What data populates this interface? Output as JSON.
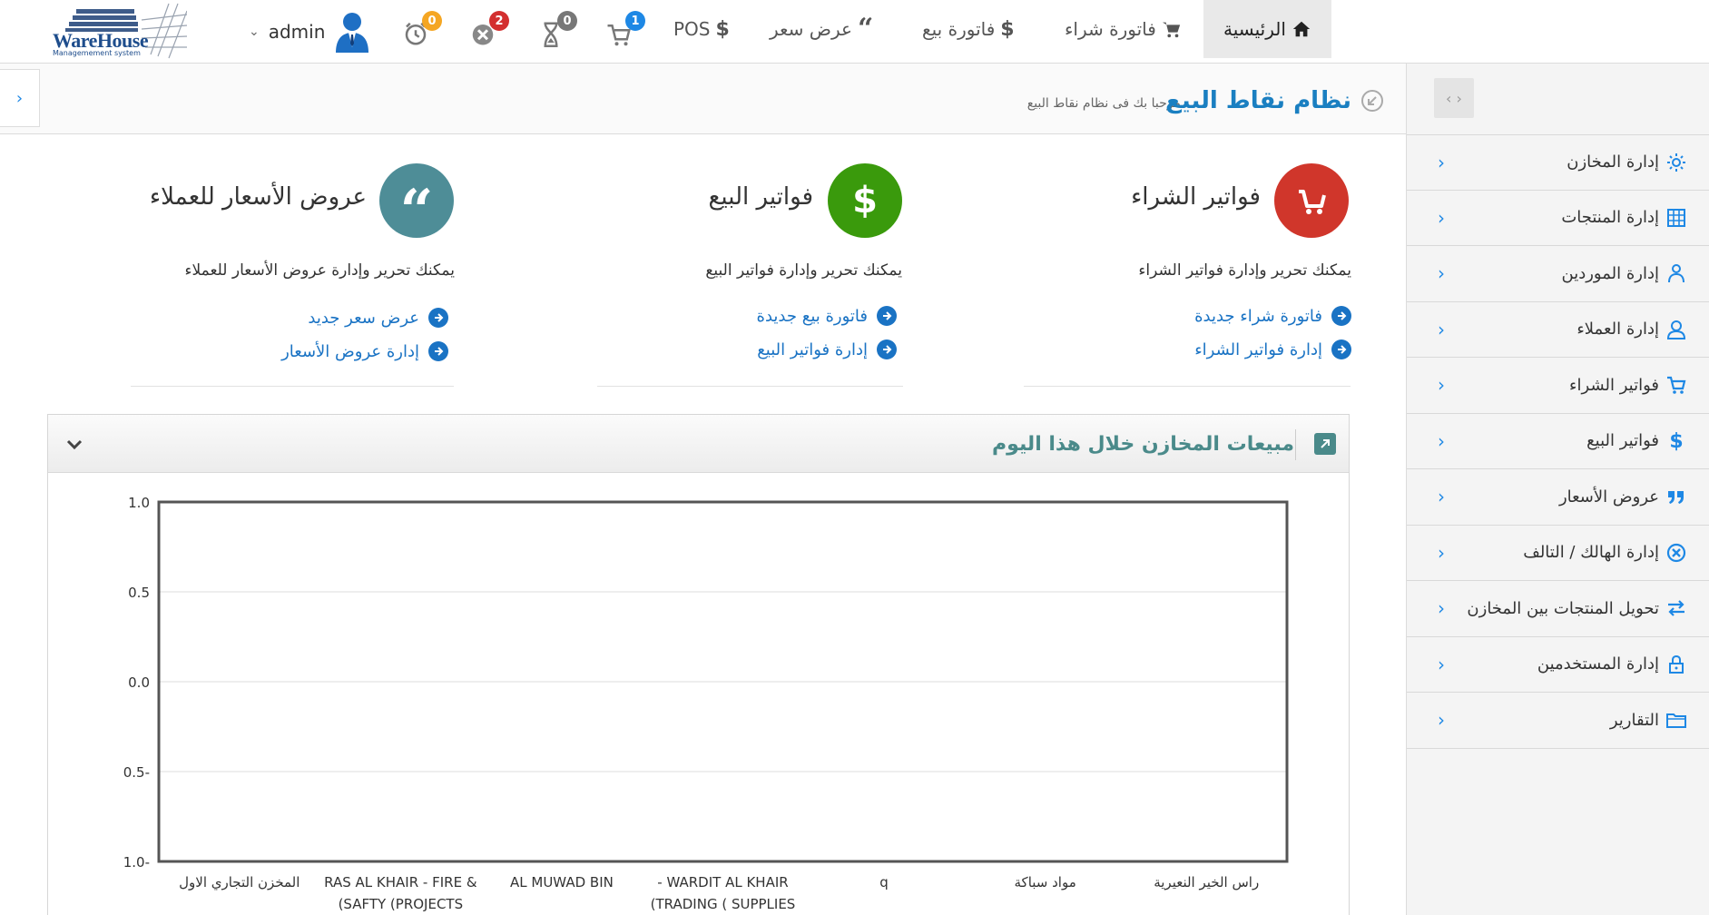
{
  "app": {
    "logo_main": "WareHouse",
    "logo_sub": "Managemement system"
  },
  "topnav": {
    "home": "الرئيسية",
    "purchase_invoice": "فاتورة شراء",
    "sales_invoice": "فاتورة بيع",
    "quote": "عرض سعر",
    "pos": "POS",
    "badges": {
      "cart": "1",
      "hourglass": "0",
      "cancel": "2",
      "alarm": "0"
    },
    "user": "admin",
    "colors": {
      "cart": "#1e88e5",
      "hourglass": "#777777",
      "cancel": "#d32f2f",
      "alarm": "#f5a623"
    }
  },
  "page": {
    "title": "نظام نقاط البيع",
    "subtitle": "مرحبا بك فى نظام نقاط البيع"
  },
  "features": {
    "purchase": {
      "title": "فواتير الشراء",
      "desc": "يمكنك تحرير وإدارة فواتير الشراء",
      "link1": "فاتورة شراء جديدة",
      "link2": "إدارة فواتير الشراء",
      "color": "#d0362b"
    },
    "sales": {
      "title": "فواتير البيع",
      "desc": "يمكنك تحرير وإدارة فواتير البيع",
      "link1": "فاتورة بيع جديدة",
      "link2": "إدارة فواتير البيع",
      "color": "#3a9a0c"
    },
    "quotes": {
      "title": "عروض الأسعار للعملاء",
      "desc": "يمكنك تحرير وإدارة عروض الأسعار للعملاء",
      "link1": "عرض سعر جديد",
      "link2": "إدارة عروض الأسعار",
      "color": "#4e8d97"
    }
  },
  "sidebar": {
    "items": [
      {
        "label": "إدارة المخازن",
        "icon": "gear-icon"
      },
      {
        "label": "إدارة المنتجات",
        "icon": "grid-icon"
      },
      {
        "label": "إدارة الموردين",
        "icon": "person-icon"
      },
      {
        "label": "إدارة العملاء",
        "icon": "user-outline-icon"
      },
      {
        "label": "فواتير الشراء",
        "icon": "cart-icon"
      },
      {
        "label": "فواتير البيع",
        "icon": "dollar-icon"
      },
      {
        "label": "عروض الأسعار",
        "icon": "quote-icon"
      },
      {
        "label": "إدارة الهالك / التالف",
        "icon": "cancel-circle-icon"
      },
      {
        "label": "تحويل المنتجات بين المخازن",
        "icon": "transfer-icon"
      },
      {
        "label": "إدارة المستخدمين",
        "icon": "lock-icon"
      },
      {
        "label": "التقارير",
        "icon": "folder-icon"
      }
    ],
    "accent": "#1e88e5"
  },
  "panel": {
    "title": "مبيعات المخازن خلال هذا اليوم"
  },
  "chart_data": {
    "type": "bar",
    "categories": [
      "راس الخير النعيرية",
      "مواد سباكة",
      "q",
      "WARDIT AL KHAIR - TRADING ( SUPPLIES)",
      "AL MUWAD BIN",
      "RAS AL KHAIR - FIRE & SAFTY (PROJECTS)",
      "المخزن التجاري الاول"
    ],
    "category_lines": [
      [
        "راس الخير النعيرية"
      ],
      [
        "مواد سباكة"
      ],
      [
        "q"
      ],
      [
        "- WARDIT AL KHAIR",
        "(TRADING ( SUPPLIES"
      ],
      [
        "AL MUWAD BIN"
      ],
      [
        "RAS AL KHAIR - FIRE &",
        "(SAFTY (PROJECTS"
      ],
      [
        "المخزن التجاري الاول"
      ]
    ],
    "values": [
      0,
      0,
      0,
      0,
      0,
      0,
      0
    ],
    "x_reversed": true,
    "yticks": [
      "1.0",
      "0.5",
      "0.0",
      "0.5-",
      "1.0-"
    ],
    "ylim": [
      -1.0,
      1.0
    ],
    "grid": true
  }
}
